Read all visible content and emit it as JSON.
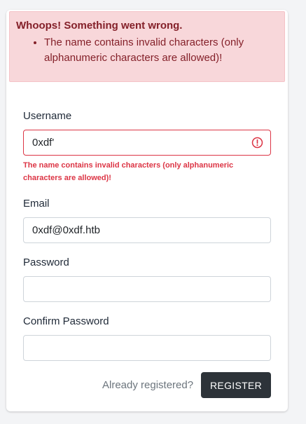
{
  "alert": {
    "title": "Whoops! Something went wrong.",
    "messages": [
      "The name contains invalid characters (only alphanumeric characters are allowed)!"
    ]
  },
  "form": {
    "username": {
      "label": "Username",
      "value": "0xdf'",
      "error": "The name contains invalid characters (only alphanumeric characters are allowed)!"
    },
    "email": {
      "label": "Email",
      "value": "0xdf@0xdf.htb"
    },
    "password": {
      "label": "Password",
      "value": ""
    },
    "confirm_password": {
      "label": "Confirm Password",
      "value": ""
    }
  },
  "actions": {
    "already_registered": "Already registered?",
    "register": "REGISTER"
  },
  "colors": {
    "error": "#dc3545",
    "alert_bg": "#f8d7da",
    "alert_text": "#842029",
    "button_bg": "#2d3339"
  },
  "icons": {
    "invalid": "exclamation-circle-icon"
  }
}
